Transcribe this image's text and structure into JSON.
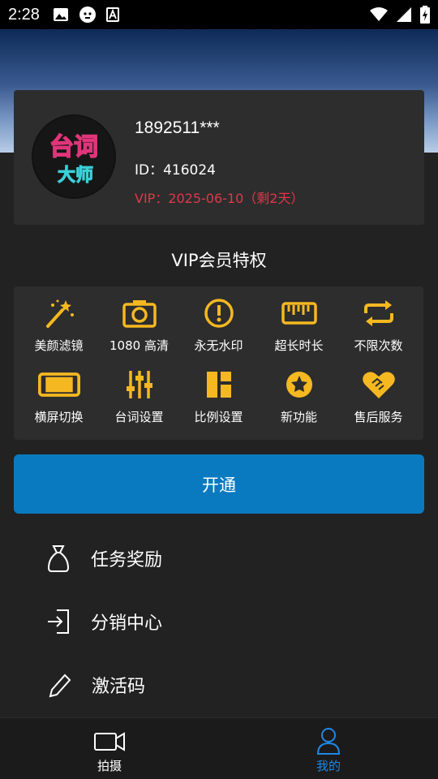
{
  "status_bar": {
    "time": "2:28",
    "icons": [
      "image-icon",
      "face-icon",
      "font-icon",
      "wifi-icon",
      "signal-icon",
      "battery-icon"
    ]
  },
  "profile": {
    "logo_text_top": "台词",
    "logo_text_bottom": "大师",
    "username": "1892511***",
    "id_line": "ID：416024",
    "vip_line": "VIP：2025-06-10（剩2天）"
  },
  "vip_section": {
    "title": "VIP会员特权",
    "features": [
      {
        "label": "美颜滤镜",
        "icon": "magic-wand-icon"
      },
      {
        "label": "1080 高清",
        "icon": "camera-icon"
      },
      {
        "label": "永无水印",
        "icon": "alert-circle-icon"
      },
      {
        "label": "超长时长",
        "icon": "ruler-icon"
      },
      {
        "label": "不限次数",
        "icon": "repeat-icon"
      },
      {
        "label": "横屏切换",
        "icon": "landscape-icon"
      },
      {
        "label": "台词设置",
        "icon": "sliders-icon"
      },
      {
        "label": "比例设置",
        "icon": "layout-icon"
      },
      {
        "label": "新功能",
        "icon": "star-badge-icon"
      },
      {
        "label": "售后服务",
        "icon": "handshake-icon"
      }
    ]
  },
  "open_button": "开通",
  "menu": [
    {
      "label": "任务奖励",
      "icon": "money-bag-icon"
    },
    {
      "label": "分销中心",
      "icon": "login-icon"
    },
    {
      "label": "激活码",
      "icon": "pencil-icon"
    }
  ],
  "bottom_nav": [
    {
      "label": "拍摄",
      "icon": "video-camera-icon",
      "active": false
    },
    {
      "label": "我的",
      "icon": "user-icon",
      "active": true
    }
  ],
  "colors": {
    "accent_gold": "#f5b820",
    "vip_red": "#e0384a",
    "button_blue": "#0a7ac0",
    "nav_active": "#1e88e5"
  }
}
